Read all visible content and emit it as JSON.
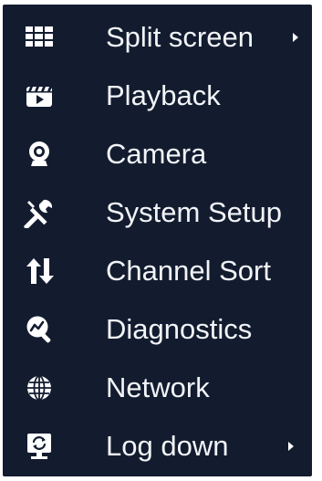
{
  "menu": {
    "items": [
      {
        "label": "Split screen",
        "icon": "grid-icon",
        "has_submenu": true
      },
      {
        "label": "Playback",
        "icon": "clapperboard-play-icon",
        "has_submenu": false
      },
      {
        "label": "Camera",
        "icon": "webcam-icon",
        "has_submenu": false
      },
      {
        "label": "System Setup",
        "icon": "tools-icon",
        "has_submenu": false
      },
      {
        "label": "Channel Sort",
        "icon": "sort-arrows-icon",
        "has_submenu": false
      },
      {
        "label": "Diagnostics",
        "icon": "search-chart-icon",
        "has_submenu": false
      },
      {
        "label": "Network",
        "icon": "globe-icon",
        "has_submenu": false
      },
      {
        "label": "Log down",
        "icon": "monitor-refresh-icon",
        "has_submenu": true
      }
    ]
  },
  "colors": {
    "background": "#131c2f",
    "text": "#f2f4f7"
  }
}
